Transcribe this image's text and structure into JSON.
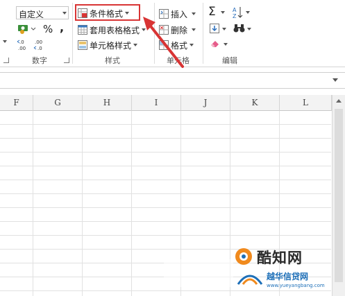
{
  "ribbon": {
    "number_format": "自定义",
    "percent": "%",
    "comma": ",",
    "inc_decimal": "←.0\n.00",
    "dec_decimal": ".00\n→.0",
    "number_group": "数字",
    "conditional_formatting": "条件格式",
    "format_as_table": "套用表格格式",
    "cell_styles": "单元格样式",
    "styles_group": "样式",
    "insert": "插入",
    "delete": "删除",
    "format": "格式",
    "cells_group": "单元格",
    "editing_group": "编辑",
    "sum_symbol": "Σ",
    "sort_symbol": "A Z"
  },
  "columns": [
    "F",
    "G",
    "H",
    "I",
    "J",
    "K",
    "L"
  ],
  "watermark": {
    "brand": "酷知网",
    "site_name": "越华信贷网",
    "url": "www.yueyangbang.com"
  },
  "colors": {
    "highlight": "#d83434",
    "arrow": "#d83434",
    "watermark_orange": "#f08a1e",
    "watermark_blue": "#1d6fb8"
  }
}
